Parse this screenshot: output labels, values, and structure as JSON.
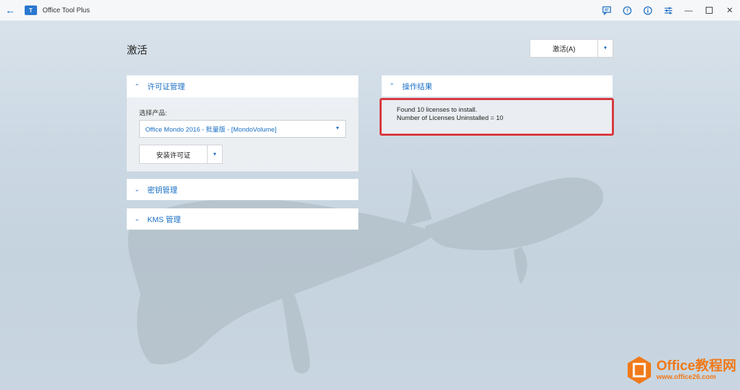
{
  "window": {
    "title": "Office Tool Plus",
    "logo_text": "T"
  },
  "titlebar_icons": [
    "feedback-icon",
    "help-icon",
    "info-icon",
    "settings-icon"
  ],
  "page": {
    "title": "激活"
  },
  "activate_button": {
    "label": "激活(A)"
  },
  "license_panel": {
    "header": "许可证管理",
    "select_label": "选择产品:",
    "selected_product": "Office Mondo 2016 - 批量版 - [MondoVolume]",
    "install_button": "安装许可证"
  },
  "key_panel": {
    "header": "密钥管理"
  },
  "kms_panel": {
    "header": "KMS 管理"
  },
  "result_panel": {
    "header": "操作结果",
    "lines": [
      "Found 10 licenses to install.",
      "Number of Licenses Uninstalled = 10"
    ]
  },
  "watermark": {
    "title": "Office教程网",
    "url": "www.office26.com"
  },
  "colors": {
    "accent": "#1a6fc4",
    "highlight_border": "#d9363c",
    "watermark": "#f07a1a"
  }
}
